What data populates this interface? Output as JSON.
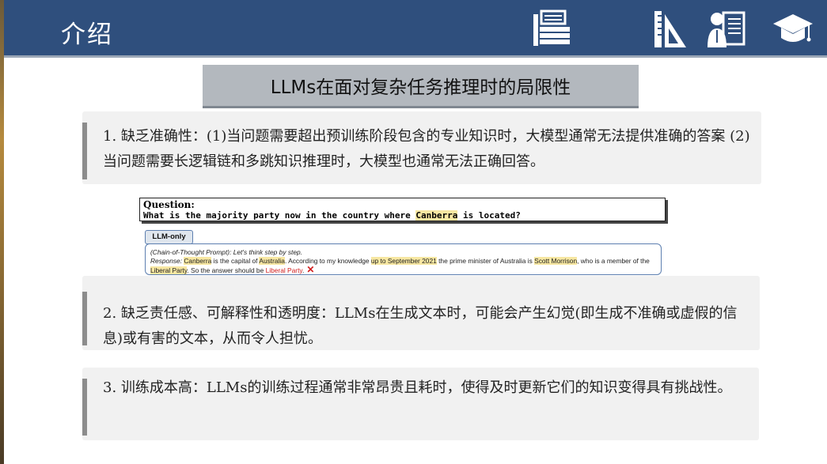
{
  "header": {
    "title": "介绍",
    "icons": [
      "books-icon",
      "ruler-triangle-icon",
      "teacher-board-icon",
      "graduation-cap-icon"
    ]
  },
  "subtitle": "LLMs在面对复杂任务推理时的局限性",
  "points": [
    "1. 缺乏准确性：(1)当问题需要超出预训练阶段包含的专业知识时，大模型通常无法提供准确的答案 (2)当问题需要长逻辑链和多跳知识推理时，大模型也通常无法正确回答。",
    "2. 缺乏责任感、可解释性和透明度：LLMs在生成文本时，可能会产生幻觉(即生成不准确或虚假的信息)或有害的文本，从而令人担忧。",
    "3. 训练成本高：LLMs的训练过程通常非常昂贵且耗时，使得及时更新它们的知识变得具有挑战性。"
  ],
  "figure": {
    "question_label": "Question:",
    "question_before": "What is the majority party now in the country where ",
    "question_highlight": "Canberra",
    "question_after": " is located?",
    "llm_tag": "LLM-only",
    "cot_prompt": "(Chain-of-Thought Prompt): Let's think step by step.",
    "response_label": "Response:",
    "r1": "Canberra",
    "r2": " is the capital of ",
    "r3": "Australia",
    "r4": ". According to my knowledge ",
    "r5": "up to September 2021",
    "r6": " the prime minister of Australia is ",
    "r7": "Scott Morrison",
    "r8": ", who is a member of the ",
    "r9": "Liberal Party",
    "r10": ". So the answer should be ",
    "r11": "Liberal Party",
    "r12": ".",
    "cross": "✕"
  },
  "colors": {
    "header_bg": "#2f4f7d",
    "subtitle_bg": "#b3b8be",
    "highlight": "#f7e7a2",
    "wrong_answer": "#d11d1d"
  }
}
